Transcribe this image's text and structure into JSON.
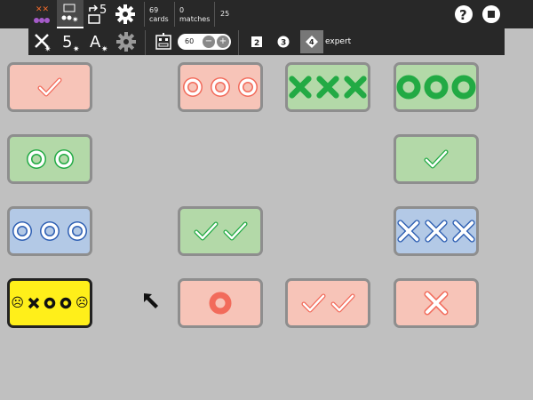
{
  "toolbar": {
    "cards_count": "69",
    "cards_label": "cards",
    "matches_count": "0",
    "matches_label": "matches",
    "score": "25",
    "custom_count_label": "5"
  },
  "subbar": {
    "digit_label": "5",
    "letter_label": "A",
    "stepper_value": "60",
    "minus_label": "−",
    "plus_label": "+",
    "levels": [
      "2",
      "3",
      "4"
    ],
    "selected_level": "4",
    "level_name": "expert"
  },
  "colors": {
    "pink": "#f7c4b8",
    "green": "#b3d9a8",
    "blue": "#b3c9e6",
    "yellow": "#ffef1a",
    "red_symbol": "#f26b5b",
    "green_symbol": "#22aa44",
    "white": "#ffffff"
  },
  "cards": [
    {
      "row": 1,
      "col": 1,
      "color": "pink",
      "symbol": "check",
      "count": 1,
      "fill": "outline"
    },
    {
      "row": 1,
      "col": 3,
      "color": "pink",
      "symbol": "circle",
      "count": 3,
      "fill": "outline"
    },
    {
      "row": 1,
      "col": 4,
      "color": "green",
      "symbol": "cross",
      "count": 3,
      "fill": "solid"
    },
    {
      "row": 1,
      "col": 5,
      "color": "green",
      "symbol": "circle",
      "count": 3,
      "fill": "solid"
    },
    {
      "row": 2,
      "col": 1,
      "color": "green",
      "symbol": "circle",
      "count": 2,
      "fill": "outline"
    },
    {
      "row": 2,
      "col": 5,
      "color": "green",
      "symbol": "check",
      "count": 1,
      "fill": "outline"
    },
    {
      "row": 3,
      "col": 1,
      "color": "blue",
      "symbol": "circle",
      "count": 3,
      "fill": "outline"
    },
    {
      "row": 3,
      "col": 3,
      "color": "green",
      "symbol": "check",
      "count": 2,
      "fill": "outline"
    },
    {
      "row": 3,
      "col": 5,
      "color": "blue",
      "symbol": "cross",
      "count": 3,
      "fill": "outline"
    },
    {
      "row": 4,
      "col": 1,
      "color": "yellow",
      "symbol": "joker",
      "count": 1,
      "fill": "solid"
    },
    {
      "row": 4,
      "col": 3,
      "color": "pink",
      "symbol": "circle",
      "count": 1,
      "fill": "solid"
    },
    {
      "row": 4,
      "col": 4,
      "color": "pink",
      "symbol": "check",
      "count": 2,
      "fill": "outline"
    },
    {
      "row": 4,
      "col": 5,
      "color": "pink",
      "symbol": "cross",
      "count": 1,
      "fill": "outline"
    }
  ]
}
